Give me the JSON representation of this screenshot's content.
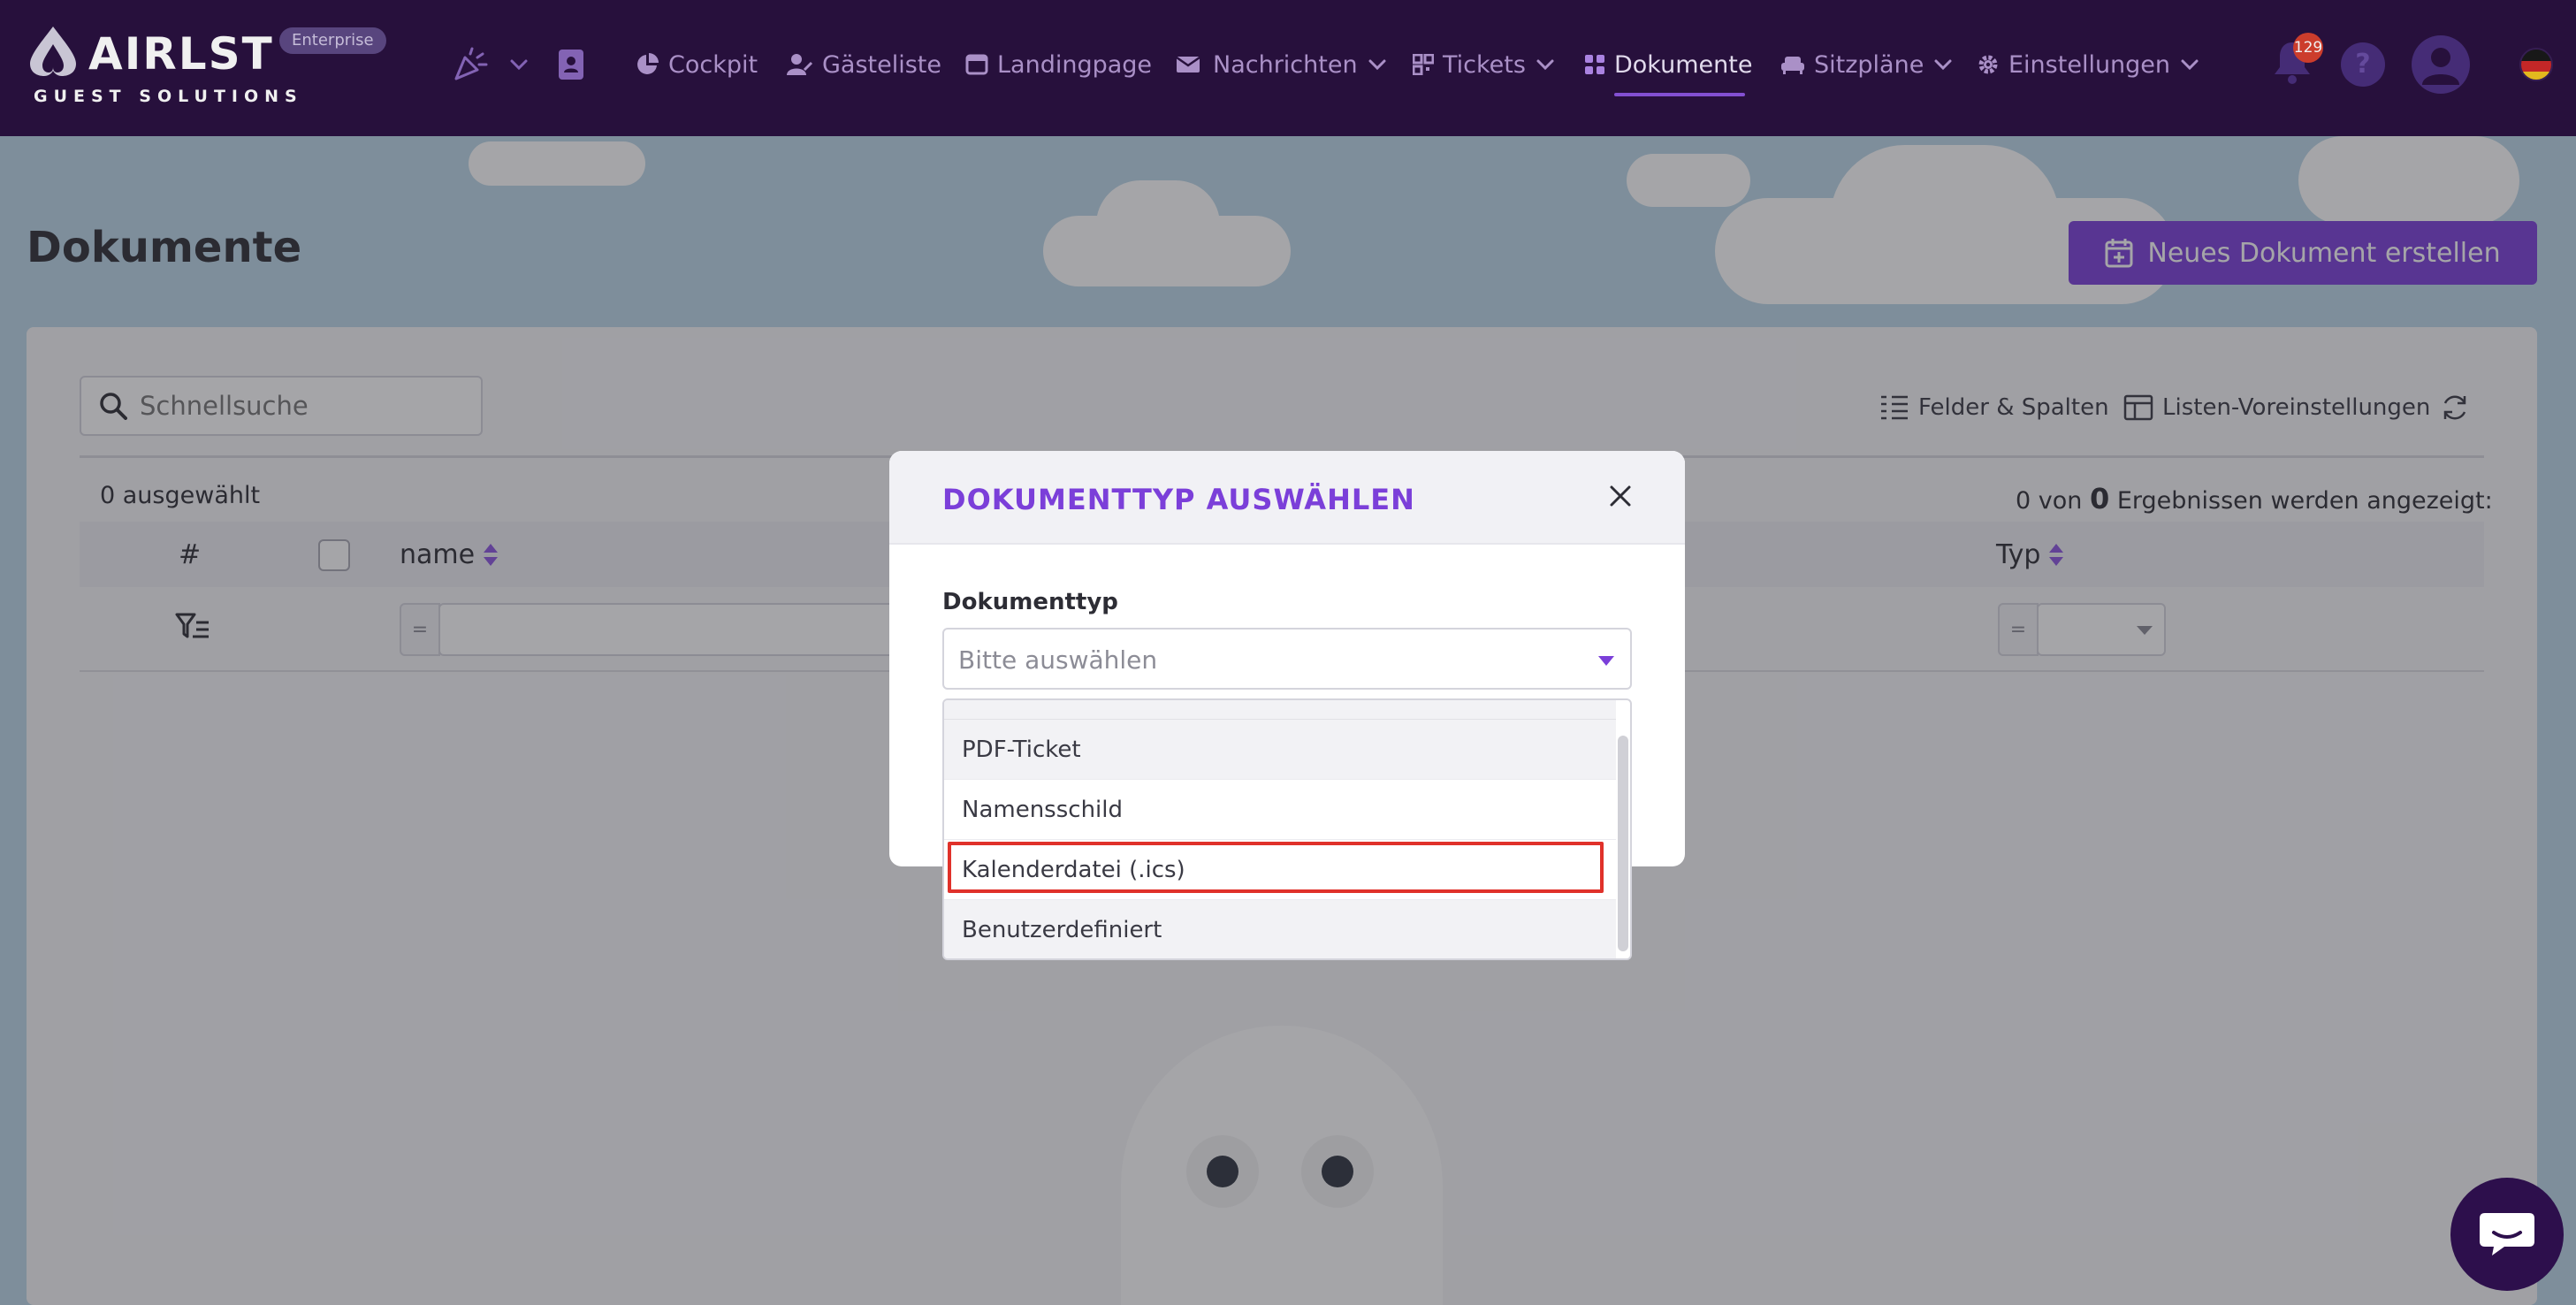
{
  "brand": {
    "name": "AIRLST",
    "tagline": "GUEST SOLUTIONS",
    "edition": "Enterprise"
  },
  "nav": {
    "items": [
      {
        "label": "Cockpit",
        "icon": "chart-pie-icon"
      },
      {
        "label": "Gästeliste",
        "icon": "user-edit-icon"
      },
      {
        "label": "Landingpage",
        "icon": "window-icon"
      },
      {
        "label": "Nachrichten",
        "icon": "envelope-icon"
      },
      {
        "label": "Tickets",
        "icon": "qrcode-icon"
      },
      {
        "label": "Dokumente",
        "icon": "grid-icon",
        "active": true
      },
      {
        "label": "Sitzpläne",
        "icon": "couch-icon"
      },
      {
        "label": "Einstellungen",
        "icon": "gear-icon"
      }
    ],
    "notification_count": "129",
    "help_label": "?"
  },
  "page": {
    "title": "Dokumente",
    "new_button": "Neues Dokument erstellen"
  },
  "list": {
    "search_placeholder": "Schnellsuche",
    "fields_columns": "Felder & Spalten",
    "list_presets": "Listen-Voreinstellungen",
    "selected_count": "0 ausgewählt",
    "results_prefix": "0 von",
    "results_count": "0",
    "results_suffix": "Ergebnissen werden angezeigt:",
    "columns": {
      "index": "#",
      "name": "name",
      "type": "Typ"
    },
    "filter_operator": "="
  },
  "modal": {
    "title": "DOKUMENTTYP AUSWÄHLEN",
    "field_label": "Dokumenttyp",
    "select_placeholder": "Bitte auswählen",
    "options": [
      "PDF-Ticket",
      "Namensschild",
      "Kalenderdatei (.ics)",
      "Benutzerdefiniert"
    ],
    "highlighted_option": "Kalenderdatei (.ics)"
  },
  "colors": {
    "nav_bg": "#2a1240",
    "accent": "#7b3fd9",
    "highlight": "#e0312a"
  }
}
